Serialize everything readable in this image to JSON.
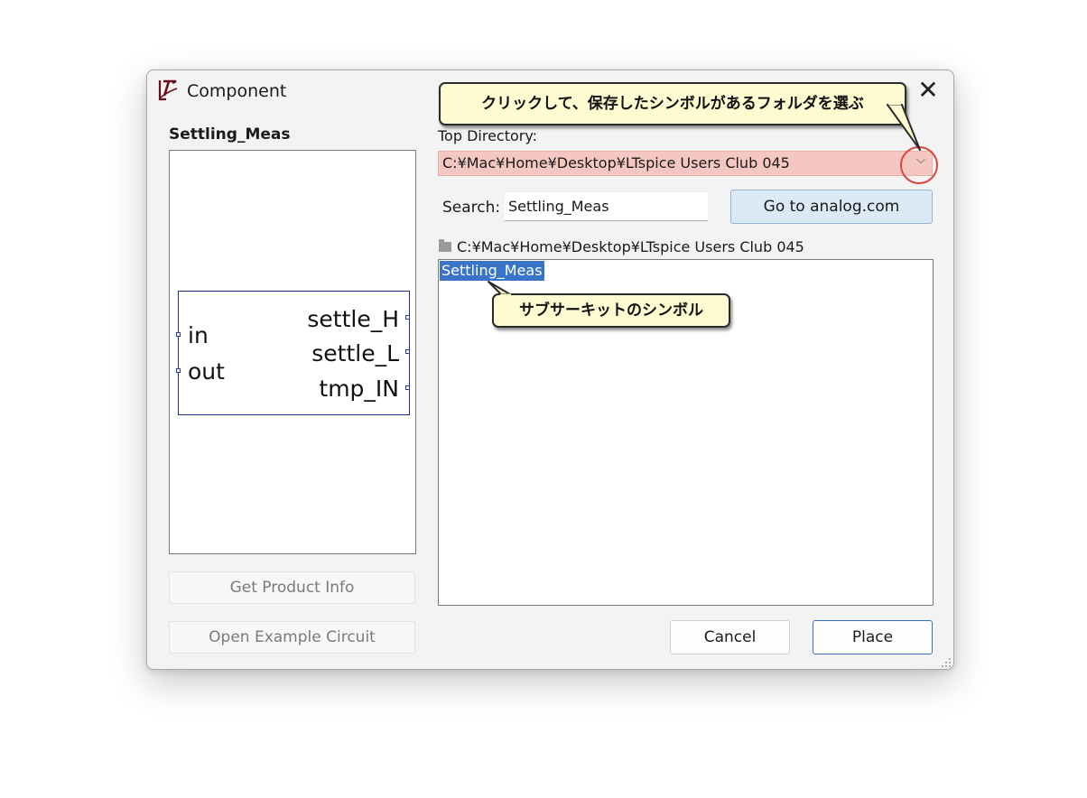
{
  "window": {
    "title": "Component",
    "close_glyph": "✕"
  },
  "component": {
    "name": "Settling_Meas",
    "symbol_pins_left": [
      "in",
      "out"
    ],
    "symbol_pins_right": [
      "settle_H",
      "settle_L",
      "tmp_IN"
    ]
  },
  "left_buttons": {
    "product_info": "Get Product Info",
    "example_circuit": "Open Example Circuit"
  },
  "directory": {
    "label": "Top Directory:",
    "value": "C:¥Mac¥Home¥Desktop¥LTspice Users Club 045",
    "dropdown_glyph": "⌵"
  },
  "search": {
    "label": "Search:",
    "value": "Settling_Meas"
  },
  "go_button": "Go to analog.com",
  "path": "C:¥Mac¥Home¥Desktop¥LTspice Users Club 045",
  "list": {
    "selected": "Settling_Meas"
  },
  "footer": {
    "cancel": "Cancel",
    "place": "Place"
  },
  "annotations": {
    "top": "クリックして、保存したシンボルがあるフォルダを選ぶ",
    "middle": "サブサーキットのシンボル"
  },
  "colors": {
    "accent": "#3a74c9",
    "highlight_combo": "#f4c7c2",
    "callout_bg": "#fffbd0",
    "circle": "#d9473a"
  }
}
